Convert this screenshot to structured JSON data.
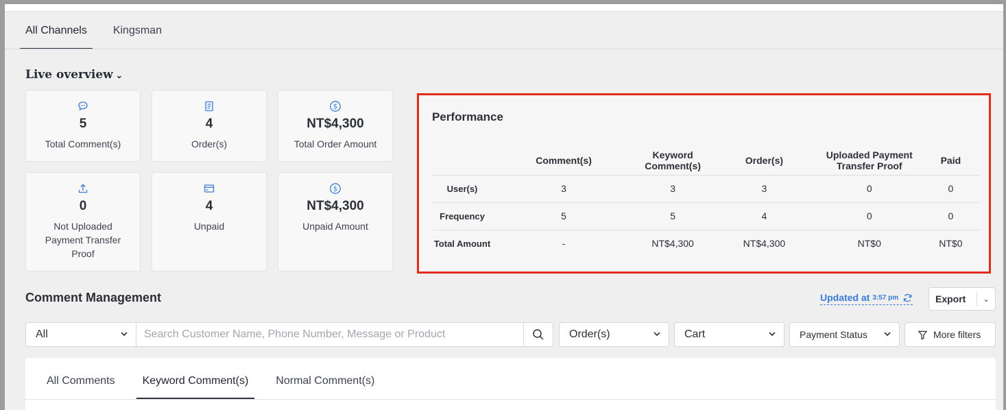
{
  "channel_tabs": [
    "All Channels",
    "Kingsman"
  ],
  "live_overview": {
    "title": "Live overview",
    "cards": [
      {
        "icon": "comment-icon",
        "value": "5",
        "label": "Total Comment(s)"
      },
      {
        "icon": "order-icon",
        "value": "4",
        "label": "Order(s)"
      },
      {
        "icon": "dollar-icon",
        "value": "NT$4,300",
        "label": "Total Order Amount"
      },
      {
        "icon": "upload-icon",
        "value": "0",
        "label": "Not Uploaded Payment Transfer Proof"
      },
      {
        "icon": "card-icon",
        "value": "4",
        "label": "Unpaid"
      },
      {
        "icon": "dollar-icon",
        "value": "NT$4,300",
        "label": "Unpaid Amount"
      }
    ]
  },
  "performance": {
    "title": "Performance",
    "columns": [
      "Comment(s)",
      "Keyword Comment(s)",
      "Order(s)",
      "Uploaded Payment Transfer Proof",
      "Paid"
    ],
    "rows": [
      {
        "label": "User(s)",
        "values": [
          "3",
          "3",
          "3",
          "0",
          "0"
        ]
      },
      {
        "label": "Frequency",
        "values": [
          "5",
          "5",
          "4",
          "0",
          "0"
        ]
      },
      {
        "label": "Total Amount",
        "values": [
          "-",
          "NT$4,300",
          "NT$4,300",
          "NT$0",
          "NT$0"
        ]
      }
    ]
  },
  "comment_management": {
    "title": "Comment Management",
    "updated_label": "Updated at",
    "updated_time": "3:57 pm",
    "export_label": "Export",
    "filters": {
      "scope": "All",
      "search_placeholder": "Search Customer Name, Phone Number, Message or Product",
      "orders": "Order(s)",
      "cart": "Cart",
      "payment_status": "Payment Status",
      "more_filters": "More filters"
    },
    "tabs": [
      "All Comments",
      "Keyword Comment(s)",
      "Normal Comment(s)"
    ],
    "active_tab": "Keyword Comment(s)"
  },
  "colors": {
    "accent": "#3a7bd5",
    "highlight_border": "#e32b1c"
  }
}
